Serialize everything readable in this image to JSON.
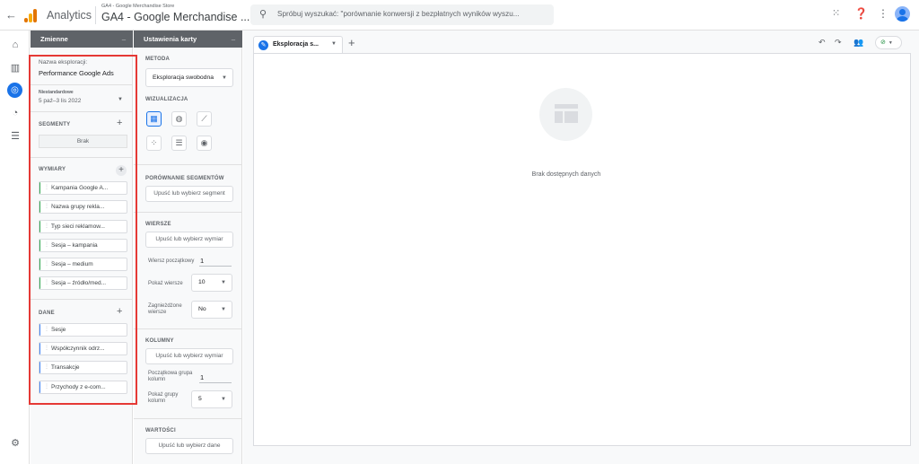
{
  "header": {
    "back_icon": "arrow-left-icon",
    "app_name": "Analytics",
    "account": "GA4 - Google Merchandise Store",
    "property": "GA4 - Google Merchandise ...",
    "search_placeholder": "Spróbuj wyszukać: \"porównanie konwersji z bezpłatnych wyników wyszu...",
    "icons": [
      "apps-grid-icon",
      "help-icon",
      "more-vert-icon",
      "account-avatar-icon"
    ]
  },
  "rail": {
    "icons": [
      "home-icon",
      "reports-icon",
      "explore-icon",
      "advertising-icon",
      "configure-icon",
      "admin-gear-icon"
    ],
    "active": "explore-icon"
  },
  "variables": {
    "header": "Zmienne",
    "name_label": "Nazwa eksploracji:",
    "name_value": "Performance Google Ads",
    "date_label": "Niestandardowe",
    "date_value": "5 paź–3 lis 2022",
    "segments_label": "SEGMENTY",
    "segments_empty": "Brak",
    "dimensions_label": "WYMIARY",
    "dimensions": [
      "Kampania Google A...",
      "Nazwa grupy rekla...",
      "Typ sieci reklamow...",
      "Sesja – kampania",
      "Sesja – medium",
      "Sesja – źródło/med..."
    ],
    "metrics_label": "DANE",
    "metrics": [
      "Sesje",
      "Współczynnik odrz...",
      "Transakcje",
      "Przychody z e-com..."
    ]
  },
  "settings": {
    "header": "Ustawienia karty",
    "method_label": "METODA",
    "method_value": "Eksploracja swobodna",
    "viz_label": "WIZUALIZACJA",
    "viz_icons": [
      "table-icon",
      "donut-chart-icon",
      "line-chart-icon",
      "scatter-plot-icon",
      "bar-chart-icon",
      "geo-map-icon"
    ],
    "segment_compare_label": "PORÓWNANIE SEGMENTÓW",
    "segment_drop": "Upuść lub wybierz segment",
    "rows_label": "WIERSZE",
    "rows_drop": "Upuść lub wybierz wymiar",
    "start_row_label": "Wiersz początkowy",
    "start_row_value": "1",
    "show_rows_label": "Pokaż wiersze",
    "show_rows_value": "10",
    "nested_rows_label": "Zagnieżdżone wiersze",
    "nested_rows_value": "No",
    "columns_label": "KOLUMNY",
    "columns_drop": "Upuść lub wybierz wymiar",
    "start_col_label": "Początkowa grupa kolumn",
    "start_col_value": "1",
    "show_col_label": "Pokaż grupy kolumn",
    "show_col_value": "5",
    "values_label": "WARTOŚCI",
    "values_drop": "Upuść lub wybierz dane"
  },
  "canvas": {
    "tab_label": "Eksploracja s...",
    "empty_text": "Brak dostępnych danych",
    "toolbar_icons": [
      "undo-icon",
      "redo-icon",
      "share-users-icon"
    ],
    "status_icon": "check-circle-icon"
  }
}
